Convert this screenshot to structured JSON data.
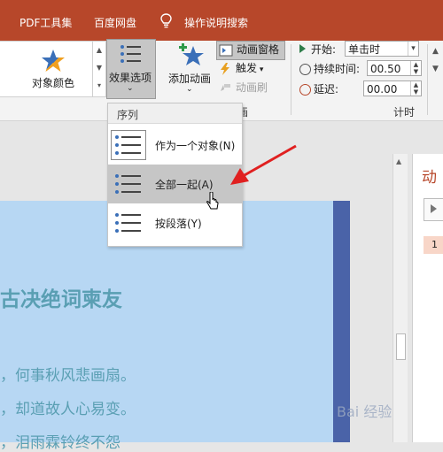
{
  "tabs": [
    "PDF工具集",
    "百度网盘",
    "操作说明搜索"
  ],
  "ribbon": {
    "object_color_label": "对象颜色",
    "effect_options_label": "效果选项",
    "add_animation_label": "添加动画",
    "animation_pane_label": "动画窗格",
    "trigger_label": "触发",
    "animation_painter_label": "动画刷",
    "timing": {
      "start_label": "开始:",
      "start_value": "单击时",
      "duration_label": "持续时间:",
      "duration_value": "00.50",
      "delay_label": "延迟:",
      "delay_value": "00.00"
    },
    "group_labels": {
      "animation": "画",
      "timing": "计时"
    }
  },
  "menu": {
    "header": "序列",
    "options": [
      {
        "label": "作为一个对象(N)"
      },
      {
        "label": "全部一起(A)"
      },
      {
        "label": "按段落(Y)"
      }
    ],
    "hovered_index": 1
  },
  "slide": {
    "lines": [
      "古决绝词柬友",
      "，何事秋风悲画扇。",
      "，却道故人心易变。",
      "，泪雨霖铃终不怨"
    ]
  },
  "animation_pane": {
    "title": "动",
    "item_number": "1"
  },
  "watermark": "Bai 经验",
  "colors": {
    "accent": "#b7472a",
    "slide_bg": "#b7d7f3",
    "slide_text": "#5a9fb3",
    "arrow": "#e02020"
  }
}
